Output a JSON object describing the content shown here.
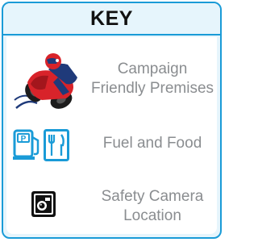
{
  "key": {
    "title": "KEY",
    "items": [
      {
        "icon": "motorcyclist-icon",
        "label_lines": [
          "Campaign",
          "Friendly Premises"
        ]
      },
      {
        "icon": "fuel-and-food-icon",
        "label_lines": [
          "Fuel and Food"
        ]
      },
      {
        "icon": "safety-camera-icon",
        "label_lines": [
          "Safety Camera",
          "Location"
        ]
      }
    ]
  },
  "colors": {
    "border": "#1a9bd7",
    "panel_background": "#e6f5fc",
    "label_text": "#8a8d90",
    "motorcycle_red": "#d8232a",
    "rider_blue": "#1f3a7a"
  }
}
